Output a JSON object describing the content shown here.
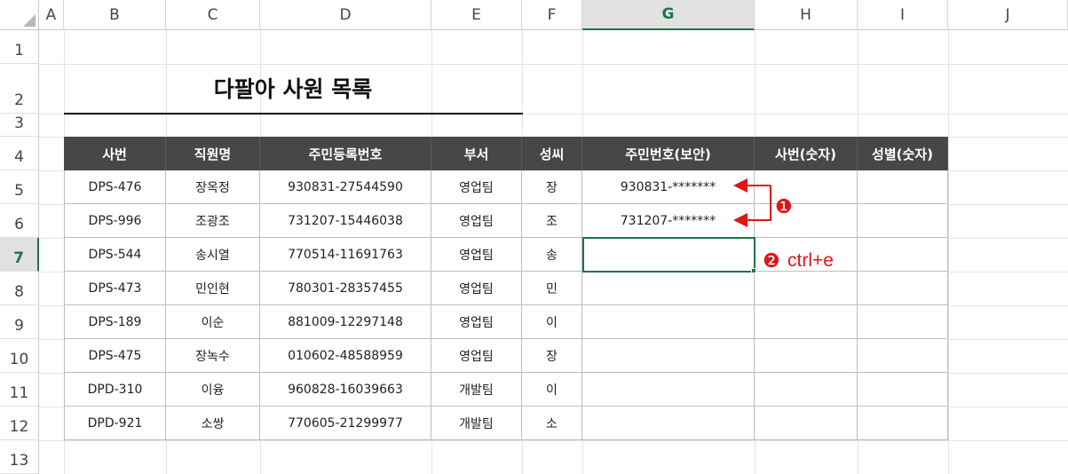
{
  "columns": [
    "A",
    "B",
    "C",
    "D",
    "E",
    "F",
    "G",
    "H",
    "I",
    "J"
  ],
  "rows": [
    "1",
    "2",
    "3",
    "4",
    "5",
    "6",
    "7",
    "8",
    "9",
    "10",
    "11",
    "12",
    "13"
  ],
  "selected_column": "G",
  "selected_row": "7",
  "title": "다팔아 사원 목록",
  "table": {
    "headers": [
      "사번",
      "직원명",
      "주민등록번호",
      "부서",
      "성씨",
      "주민번호(보안)",
      "사번(숫자)",
      "성별(숫자)"
    ],
    "rows": [
      [
        "DPS-476",
        "장옥정",
        "930831-27544590",
        "영업팀",
        "장",
        "930831-*******",
        "",
        ""
      ],
      [
        "DPS-996",
        "조광조",
        "731207-15446038",
        "영업팀",
        "조",
        "731207-*******",
        "",
        ""
      ],
      [
        "DPS-544",
        "송시열",
        "770514-11691763",
        "영업팀",
        "송",
        "",
        "",
        ""
      ],
      [
        "DPS-473",
        "민인현",
        "780301-28357455",
        "영업팀",
        "민",
        "",
        "",
        ""
      ],
      [
        "DPS-189",
        "이순",
        "881009-12297148",
        "영업팀",
        "이",
        "",
        "",
        ""
      ],
      [
        "DPS-475",
        "장녹수",
        "010602-48588959",
        "영업팀",
        "장",
        "",
        "",
        ""
      ],
      [
        "DPD-310",
        "이융",
        "960828-16039663",
        "개발팀",
        "이",
        "",
        "",
        ""
      ],
      [
        "DPD-921",
        "소쌍",
        "770605-21299977",
        "개발팀",
        "소",
        "",
        "",
        ""
      ]
    ]
  },
  "annotations": {
    "step1_badge": "❶",
    "step2_badge": "❷",
    "step2_text": "ctrl+e"
  },
  "colors": {
    "header_bg": "#474747",
    "selection": "#217346",
    "annotation": "#e01515"
  }
}
